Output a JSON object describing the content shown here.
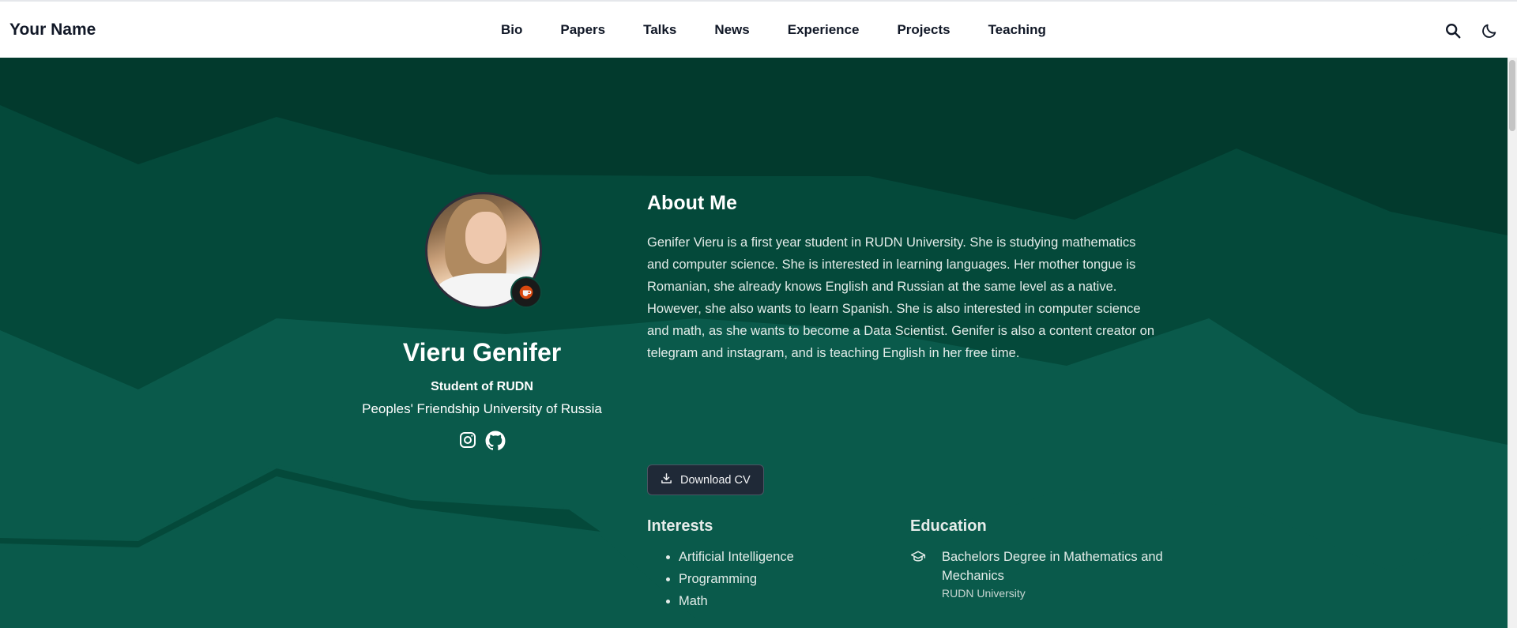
{
  "navbar": {
    "brand": "Your Name",
    "links": [
      "Bio",
      "Papers",
      "Talks",
      "News",
      "Experience",
      "Projects",
      "Teaching"
    ],
    "search_icon": "search-icon",
    "theme_icon": "moon-icon"
  },
  "profile": {
    "name": "Vieru Genifer",
    "role": "Student of RUDN",
    "organization": "Peoples' Friendship University of Russia",
    "badge_icon": "coffee-icon",
    "social_icons": [
      "instagram-icon",
      "github-icon"
    ]
  },
  "about": {
    "title": "About Me",
    "text": "Genifer Vieru is a first year student in RUDN University. She is studying mathematics and computer science. She is interested in learning languages. Her mother tongue is Romanian, she already knows English and Russian at the same level as a native. However, she also wants to learn Spanish. She is also interested in computer science and math, as she wants to become a Data Scientist. Genifer is also a content creator on telegram and instagram, and is teaching English in her free time.",
    "cv_button": "Download CV",
    "cv_icon": "download-icon"
  },
  "interests": {
    "title": "Interests",
    "items": [
      "Artificial Intelligence",
      "Programming",
      "Math"
    ]
  },
  "education": {
    "title": "Education",
    "icon": "graduation-cap-icon",
    "degree": "Bachelors Degree in Mathematics and Mechanics",
    "school": "RUDN University"
  },
  "colors": {
    "hero_dark": "#023a2d",
    "hero_mid": "#04493a",
    "hero_light": "#0a5a4b",
    "navbar_bg": "#ffffff"
  }
}
